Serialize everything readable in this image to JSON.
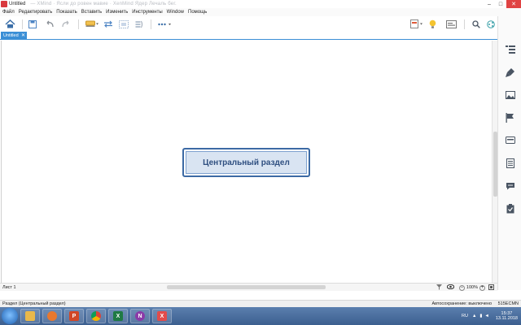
{
  "window": {
    "title": "Untitled",
    "title_blurred": "— XMind  ·  Ясли до ровен мавие  ·  XenMind Ядер Лечаль бег.",
    "icon": "xmind-app-icon"
  },
  "menubar": {
    "items": [
      "Файл",
      "Редактировать",
      "Показать",
      "Вставить",
      "Изменить",
      "Инструменты",
      "Window",
      "Помощь"
    ]
  },
  "toolbar": {
    "icons": [
      "home-icon",
      "save-icon",
      "undo-icon",
      "redo-icon",
      "topic-style-icon",
      "relationship-icon",
      "boundary-icon",
      "summary-icon",
      "more-icon",
      "insert-icon",
      "idea-bulb-icon",
      "presentation-icon",
      "search-icon",
      "share-icon",
      "layout-icon"
    ]
  },
  "tabs": [
    {
      "label": "Untitled",
      "active": true
    }
  ],
  "canvas": {
    "central_topic": "Центральный раздел"
  },
  "right_panel": {
    "icons": [
      "outline-icon",
      "format-brush-icon",
      "image-icon",
      "marker-flag-icon",
      "labels-icon",
      "notes-icon",
      "comments-icon",
      "task-icon"
    ]
  },
  "bottombar": {
    "sheet_label": "Лист 1",
    "zoom": "100%"
  },
  "statusbar": {
    "selection": "Раздел (Центральный раздел)",
    "autosave": "Автосохранение: выключено",
    "user": "515ECMN"
  },
  "taskbar": {
    "apps": [
      {
        "name": "explorer-icon",
        "color": "#e8b84a",
        "glyph": ""
      },
      {
        "name": "media-player-icon",
        "color": "#e7782f",
        "glyph": ""
      },
      {
        "name": "powerpoint-icon",
        "color": "#d24726",
        "glyph": "P"
      },
      {
        "name": "chrome-icon",
        "color": "#3aa757",
        "glyph": ""
      },
      {
        "name": "excel-icon",
        "color": "#1f7a44",
        "glyph": "X"
      },
      {
        "name": "onenote-icon",
        "color": "#8b3aa8",
        "glyph": "N"
      },
      {
        "name": "xmind-icon",
        "color": "#e24b4b",
        "glyph": "X"
      }
    ],
    "lang": "RU",
    "time": "15:37",
    "date": "13.11.2018"
  }
}
